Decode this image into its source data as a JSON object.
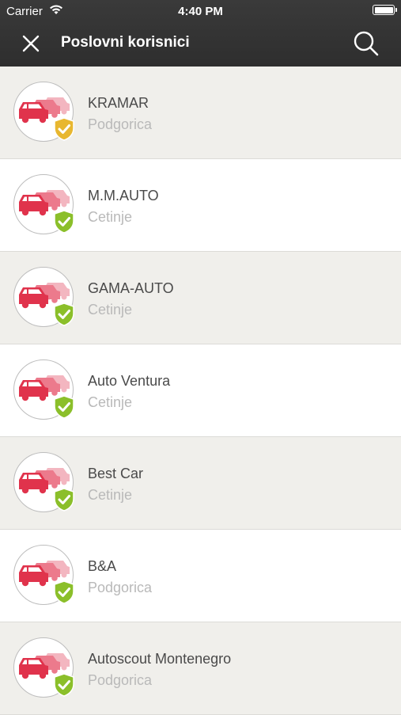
{
  "status_bar": {
    "carrier": "Carrier",
    "time": "4:40 PM"
  },
  "header": {
    "title": "Poslovni korisnici"
  },
  "colors": {
    "header_bg": "#333333",
    "car_red": "#e0334c",
    "shield_green": "#8bbf2a",
    "shield_gold": "#e8b730"
  },
  "items": [
    {
      "name": "KRAMAR",
      "city": "Podgorica",
      "shield": "gold"
    },
    {
      "name": "M.M.AUTO",
      "city": "Cetinje",
      "shield": "green"
    },
    {
      "name": "GAMA-AUTO",
      "city": "Cetinje",
      "shield": "green"
    },
    {
      "name": "Auto Ventura",
      "city": "Cetinje",
      "shield": "green"
    },
    {
      "name": "Best Car",
      "city": "Cetinje",
      "shield": "green"
    },
    {
      "name": "B&A",
      "city": "Podgorica",
      "shield": "green"
    },
    {
      "name": "Autoscout Montenegro",
      "city": "Podgorica",
      "shield": "green"
    }
  ]
}
